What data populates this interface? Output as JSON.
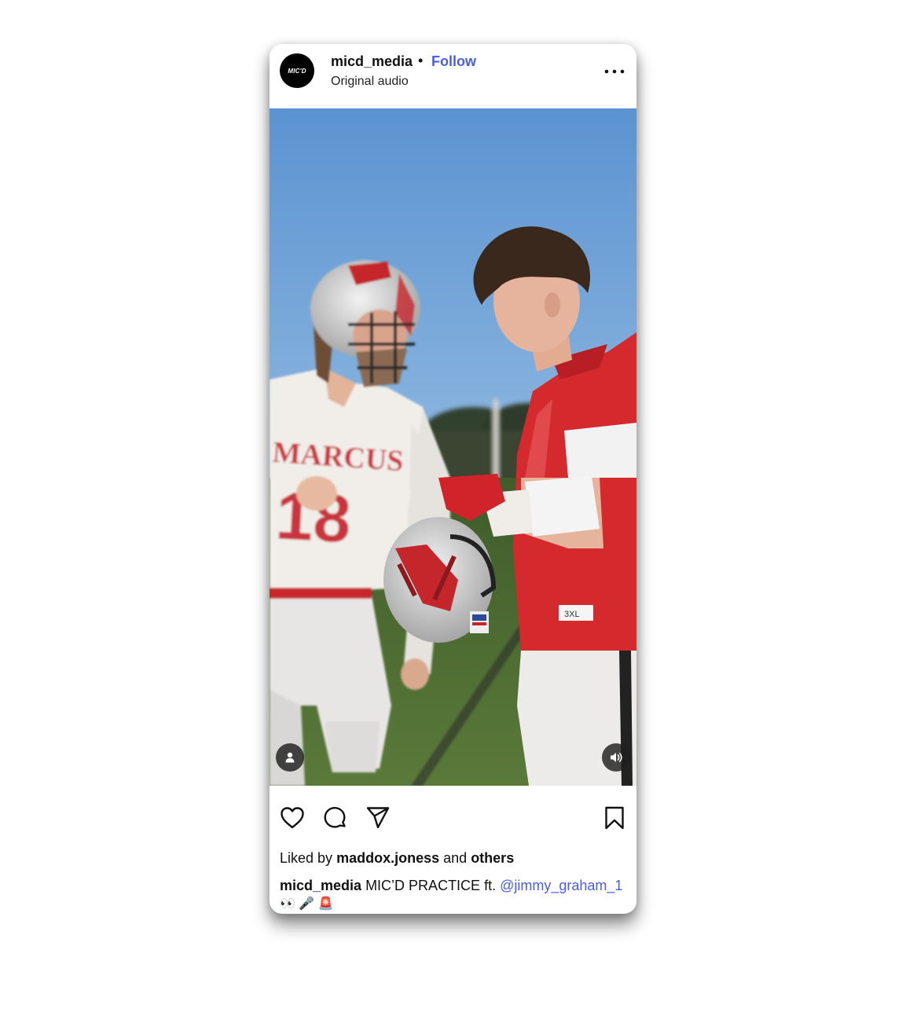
{
  "post": {
    "header": {
      "avatar_text": "MIC'D",
      "username": "micd_media",
      "separator": "•",
      "follow_label": "Follow",
      "audio": "Original audio",
      "more_icon": "more-horizontal-icon"
    },
    "media": {
      "description_colors": {
        "sky_top": "#5e95d2",
        "sky_bottom": "#aac9e6",
        "field": "#4e6e33",
        "jersey_red": "#d42a2e",
        "jersey_white": "#f1eeea"
      },
      "jersey_text": "MARCUS",
      "jersey_number": "18",
      "tag_icon": "person-icon",
      "sound_icon": "speaker-icon"
    },
    "actions": {
      "like_icon": "heart-icon",
      "comment_icon": "comment-icon",
      "share_icon": "send-icon",
      "save_icon": "bookmark-icon"
    },
    "likes": {
      "prefix": "Liked by",
      "user": "maddox.joness",
      "middle": "and",
      "others": "others"
    },
    "caption": {
      "username": "micd_media",
      "text": "MIC’D PRACTICE ft.",
      "mention": "@jimmy_graham_1",
      "emojis": "👀 🎤 🚨"
    },
    "colors": {
      "accent": "#4a5de8",
      "text": "#111111"
    }
  }
}
